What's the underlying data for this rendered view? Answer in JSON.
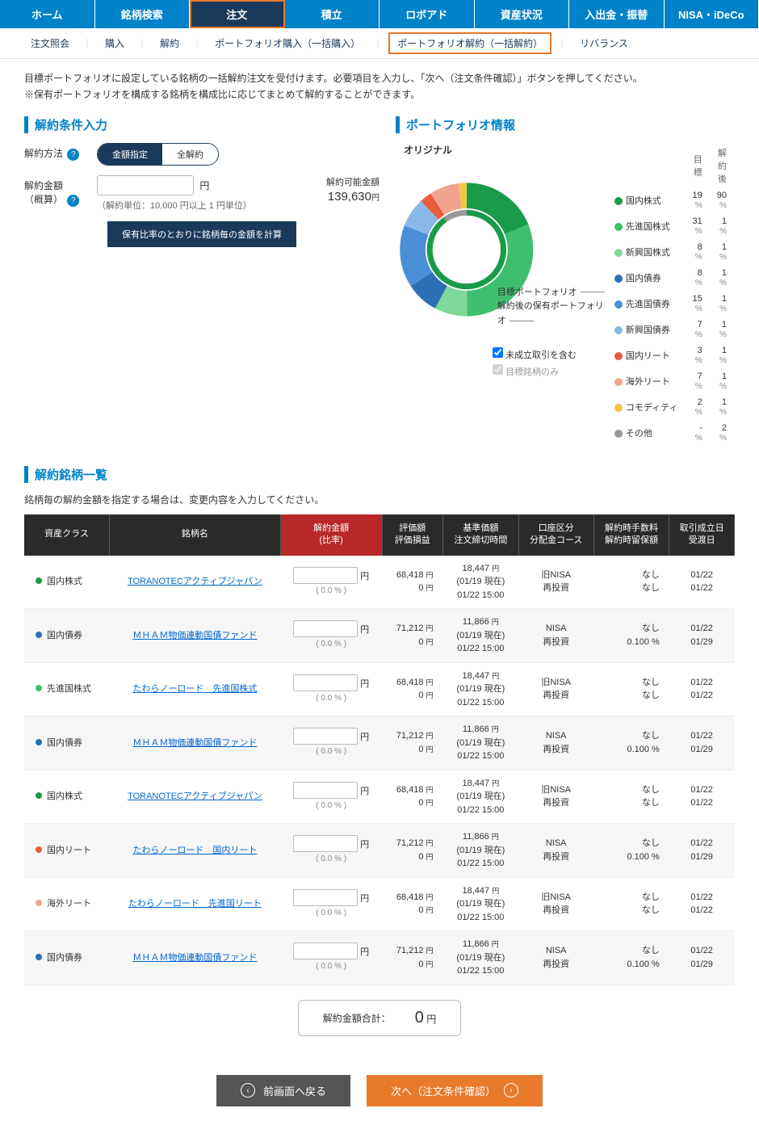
{
  "topnav": [
    "ホーム",
    "銘柄検索",
    "注文",
    "積立",
    "ロボアド",
    "資産状況",
    "入出金・振替",
    "NISA・iDeCo"
  ],
  "topnav_active": 2,
  "subnav": [
    "注文照会",
    "購入",
    "解約",
    "ポートフォリオ購入（一括購入）",
    "ポートフォリオ解約（一括解約）",
    "リバランス"
  ],
  "subnav_active": 4,
  "intro1": "目標ポートフォリオに設定している銘柄の一括解約注文を受付けます。必要項目を入力し、「次へ（注文条件確認）」ボタンを押してください。",
  "intro2": "※保有ポートフォリオを構成する銘柄を構成比に応じてまとめて解約することができます。",
  "sec1_title": "解約条件入力",
  "sec2_title": "ポートフォリオ情報",
  "form": {
    "method_label": "解約方法",
    "toggle_a": "金額指定",
    "toggle_b": "全解約",
    "amount_label": "解約金額",
    "amount_sub": "（概算）",
    "yen": "円",
    "unit_note": "（解約単位：10,000 円以上 1 円単位）",
    "possible_label": "解約可能金額",
    "possible_value": "139,630",
    "possible_yen": "円",
    "calc_btn": "保有比率のとおりに銘柄毎の金額を計算"
  },
  "donut": {
    "title": "オリジナル",
    "label1": "目標ポートフォリオ",
    "label2": "解約後の保有ポートフォリオ",
    "chk1": "未成立取引を含む",
    "chk2": "目標銘柄のみ"
  },
  "chart_data": {
    "type": "pie",
    "title": "オリジナル",
    "series": [
      {
        "name": "目標",
        "categories": [
          "国内株式",
          "先進国株式",
          "新興国株式",
          "国内債券",
          "先進国債券",
          "新興国債券",
          "国内リート",
          "海外リート",
          "コモディティ",
          "その他"
        ],
        "values_pct": [
          19,
          31,
          8,
          8,
          15,
          7,
          3,
          7,
          2,
          null
        ]
      },
      {
        "name": "解約後",
        "categories": [
          "国内株式",
          "先進国株式",
          "新興国株式",
          "国内債券",
          "先進国債券",
          "新興国債券",
          "国内リート",
          "海外リート",
          "コモディティ",
          "その他"
        ],
        "values_pct": [
          90,
          1,
          1,
          1,
          1,
          1,
          1,
          1,
          1,
          2
        ]
      }
    ]
  },
  "legend": {
    "hdr1": "目標",
    "hdr2": "解約後",
    "rows": [
      {
        "color": "#1a9b4a",
        "name": "国内株式",
        "a": "19",
        "b": "90"
      },
      {
        "color": "#3fbf6e",
        "name": "先進国株式",
        "a": "31",
        "b": "1"
      },
      {
        "color": "#7fd99a",
        "name": "新興国株式",
        "a": "8",
        "b": "1"
      },
      {
        "color": "#2b6fb5",
        "name": "国内債券",
        "a": "8",
        "b": "1"
      },
      {
        "color": "#4a8fd6",
        "name": "先進国債券",
        "a": "15",
        "b": "1"
      },
      {
        "color": "#8ab8e6",
        "name": "新興国債券",
        "a": "7",
        "b": "1"
      },
      {
        "color": "#e85c3c",
        "name": "国内リート",
        "a": "3",
        "b": "1"
      },
      {
        "color": "#f2a48f",
        "name": "海外リート",
        "a": "7",
        "b": "1"
      },
      {
        "color": "#f2c641",
        "name": "コモディティ",
        "a": "2",
        "b": "1"
      },
      {
        "color": "#999999",
        "name": "その他",
        "a": "-",
        "b": "2"
      }
    ],
    "pct": "%"
  },
  "assets": {
    "title": "解約銘柄一覧",
    "intro": "銘柄毎の解約金額を指定する場合は、変更内容を入力してください。",
    "headers": [
      "資産クラス",
      "銘柄名",
      "解約金額\n(比率)",
      "評価額\n評価損益",
      "基準価額\n注文締切時間",
      "口座区分\n分配金コース",
      "解約時手数料\n解約時留保額",
      "取引成立日\n受渡日"
    ],
    "rows": [
      {
        "color": "#1a9b4a",
        "cls": "国内株式",
        "name": "TORANOTECアクティブジャパン",
        "ratio": "( 0.0 % )",
        "eval": "68,418",
        "pl": "0",
        "price": "18,447",
        "asof": "(01/19 現在)",
        "deadline": "01/22 15:00",
        "acct": "旧NISA",
        "dist": "再投資",
        "fee1": "なし",
        "fee2": "なし",
        "d1": "01/22",
        "d2": "01/22"
      },
      {
        "color": "#2b6fb5",
        "cls": "国内債券",
        "name": "ＭＨＡＭ物価連動国債ファンド",
        "ratio": "( 0.0 % )",
        "eval": "71,212",
        "pl": "0",
        "price": "11,866",
        "asof": "(01/19 現在)",
        "deadline": "01/22 15:00",
        "acct": "NISA",
        "dist": "再投資",
        "fee1": "なし",
        "fee2": "0.100 %",
        "d1": "01/22",
        "d2": "01/29"
      },
      {
        "color": "#3fbf6e",
        "cls": "先進国株式",
        "name": "たわらノーロード　先進国株式",
        "ratio": "( 0.0 % )",
        "eval": "68,418",
        "pl": "0",
        "price": "18,447",
        "asof": "(01/19 現在)",
        "deadline": "01/22 15:00",
        "acct": "旧NISA",
        "dist": "再投資",
        "fee1": "なし",
        "fee2": "なし",
        "d1": "01/22",
        "d2": "01/22"
      },
      {
        "color": "#2b6fb5",
        "cls": "国内債券",
        "name": "ＭＨＡＭ物価連動国債ファンド",
        "ratio": "( 0.0 % )",
        "eval": "71,212",
        "pl": "0",
        "price": "11,866",
        "asof": "(01/19 現在)",
        "deadline": "01/22 15:00",
        "acct": "NISA",
        "dist": "再投資",
        "fee1": "なし",
        "fee2": "0.100 %",
        "d1": "01/22",
        "d2": "01/29"
      },
      {
        "color": "#1a9b4a",
        "cls": "国内株式",
        "name": "TORANOTECアクティブジャパン",
        "ratio": "( 0.0 % )",
        "eval": "68,418",
        "pl": "0",
        "price": "18,447",
        "asof": "(01/19 現在)",
        "deadline": "01/22 15:00",
        "acct": "旧NISA",
        "dist": "再投資",
        "fee1": "なし",
        "fee2": "なし",
        "d1": "01/22",
        "d2": "01/22"
      },
      {
        "color": "#e85c3c",
        "cls": "国内リート",
        "name": "たわらノーロード　国内リート",
        "ratio": "( 0.0 % )",
        "eval": "71,212",
        "pl": "0",
        "price": "11,866",
        "asof": "(01/19 現在)",
        "deadline": "01/22 15:00",
        "acct": "NISA",
        "dist": "再投資",
        "fee1": "なし",
        "fee2": "0.100 %",
        "d1": "01/22",
        "d2": "01/29"
      },
      {
        "color": "#f2a48f",
        "cls": "海外リート",
        "name": "たわらノーロード　先進国リート",
        "ratio": "( 0.0 % )",
        "eval": "68,418",
        "pl": "0",
        "price": "18,447",
        "asof": "(01/19 現在)",
        "deadline": "01/22 15:00",
        "acct": "旧NISA",
        "dist": "再投資",
        "fee1": "なし",
        "fee2": "なし",
        "d1": "01/22",
        "d2": "01/22"
      },
      {
        "color": "#2b6fb5",
        "cls": "国内債券",
        "name": "ＭＨＡＭ物価連動国債ファンド",
        "ratio": "( 0.0 % )",
        "eval": "71,212",
        "pl": "0",
        "price": "11,866",
        "asof": "(01/19 現在)",
        "deadline": "01/22 15:00",
        "acct": "NISA",
        "dist": "再投資",
        "fee1": "なし",
        "fee2": "0.100 %",
        "d1": "01/22",
        "d2": "01/29"
      }
    ],
    "yen": "円",
    "total_label": "解約金額合計：",
    "total_value": "0",
    "total_yen": "円"
  },
  "buttons": {
    "back": "前画面へ戻る",
    "next": "次へ（注文条件確認）"
  }
}
